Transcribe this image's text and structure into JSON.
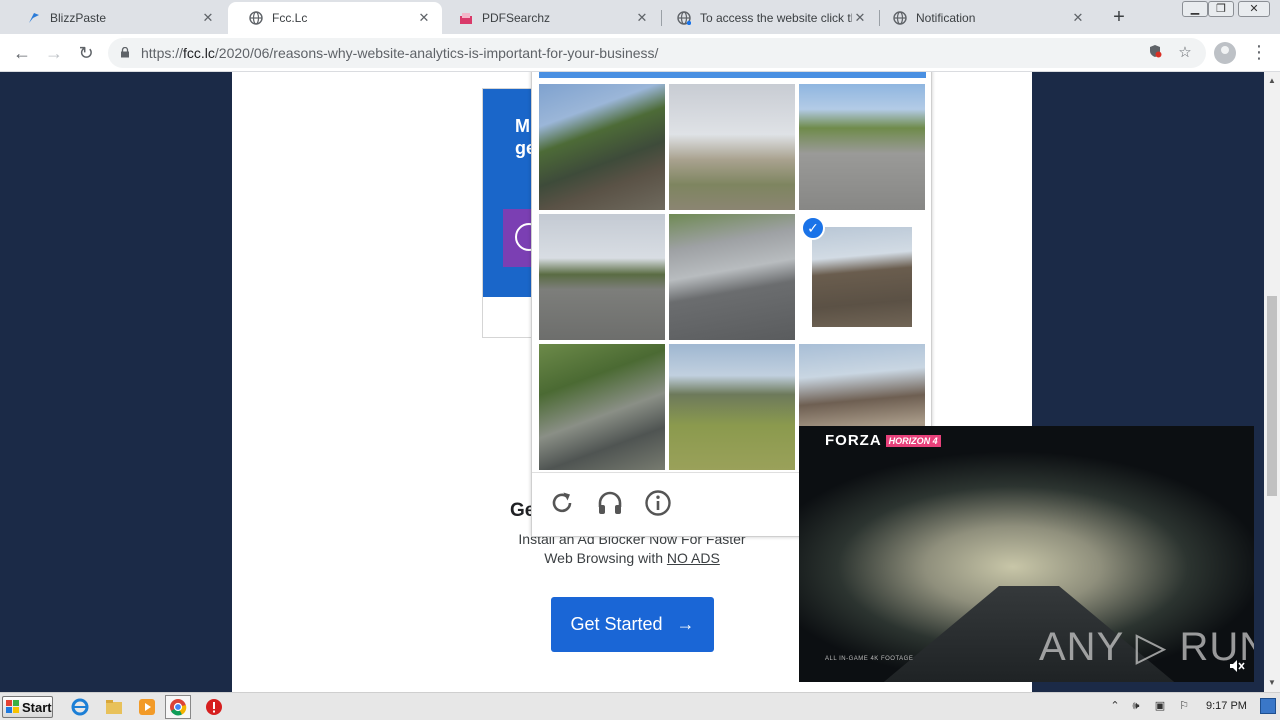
{
  "browser": {
    "tabs": [
      {
        "title": "BlizzPaste",
        "icon": "blizzpaste-favicon"
      },
      {
        "title": "Fcc.Lc",
        "icon": "globe-icon"
      },
      {
        "title": "PDFSearchz",
        "icon": "pdfsearchz-favicon"
      },
      {
        "title": "To access the website click the '",
        "icon": "globe-icon"
      },
      {
        "title": "Notification",
        "icon": "globe-icon"
      }
    ],
    "active_tab_index": 1,
    "url_scheme": "https://",
    "url_host": "fcc.lc",
    "url_path": "/2020/06/reasons-why-website-analytics-is-important-for-your-business/"
  },
  "page": {
    "ad_text_line1": "M",
    "ad_text_line2": "ge",
    "promo_title": "Ge",
    "promo_sub_line1": "Install an Ad Blocker Now For Faster",
    "promo_sub_line2_prefix": "Web Browsing with ",
    "promo_sub_link": "NO ADS",
    "cta_label": "Get Started",
    "cta_arrow": "→"
  },
  "captcha": {
    "header_color": "#4a90e2",
    "tiles": [
      {
        "scene": "house-roof-trees",
        "selected": false
      },
      {
        "scene": "highway-overpass",
        "selected": false
      },
      {
        "scene": "road-with-car",
        "selected": false
      },
      {
        "scene": "road-lanes",
        "selected": false
      },
      {
        "scene": "highway-guardrail",
        "selected": false
      },
      {
        "scene": "house-chimney",
        "selected": true
      },
      {
        "scene": "tree-driveway",
        "selected": false
      },
      {
        "scene": "bridge-grass",
        "selected": false
      },
      {
        "scene": "house-suburban",
        "selected": false
      }
    ],
    "footer_icons": [
      "reload-icon",
      "audio-headphones-icon",
      "info-icon"
    ]
  },
  "video_ad": {
    "brand": "FORZA",
    "subtitle": "HORIZON 4",
    "footnote": "ALL IN-GAME 4K FOOTAGE",
    "watermark": "ANY ▷ RUN",
    "muted_icon": "mute-icon"
  },
  "taskbar": {
    "start_label": "Start",
    "clock": "9:17 PM"
  },
  "colors": {
    "page_background": "#1b2a47",
    "cta_blue": "#1a66d6",
    "check_blue": "#1a73e8"
  }
}
